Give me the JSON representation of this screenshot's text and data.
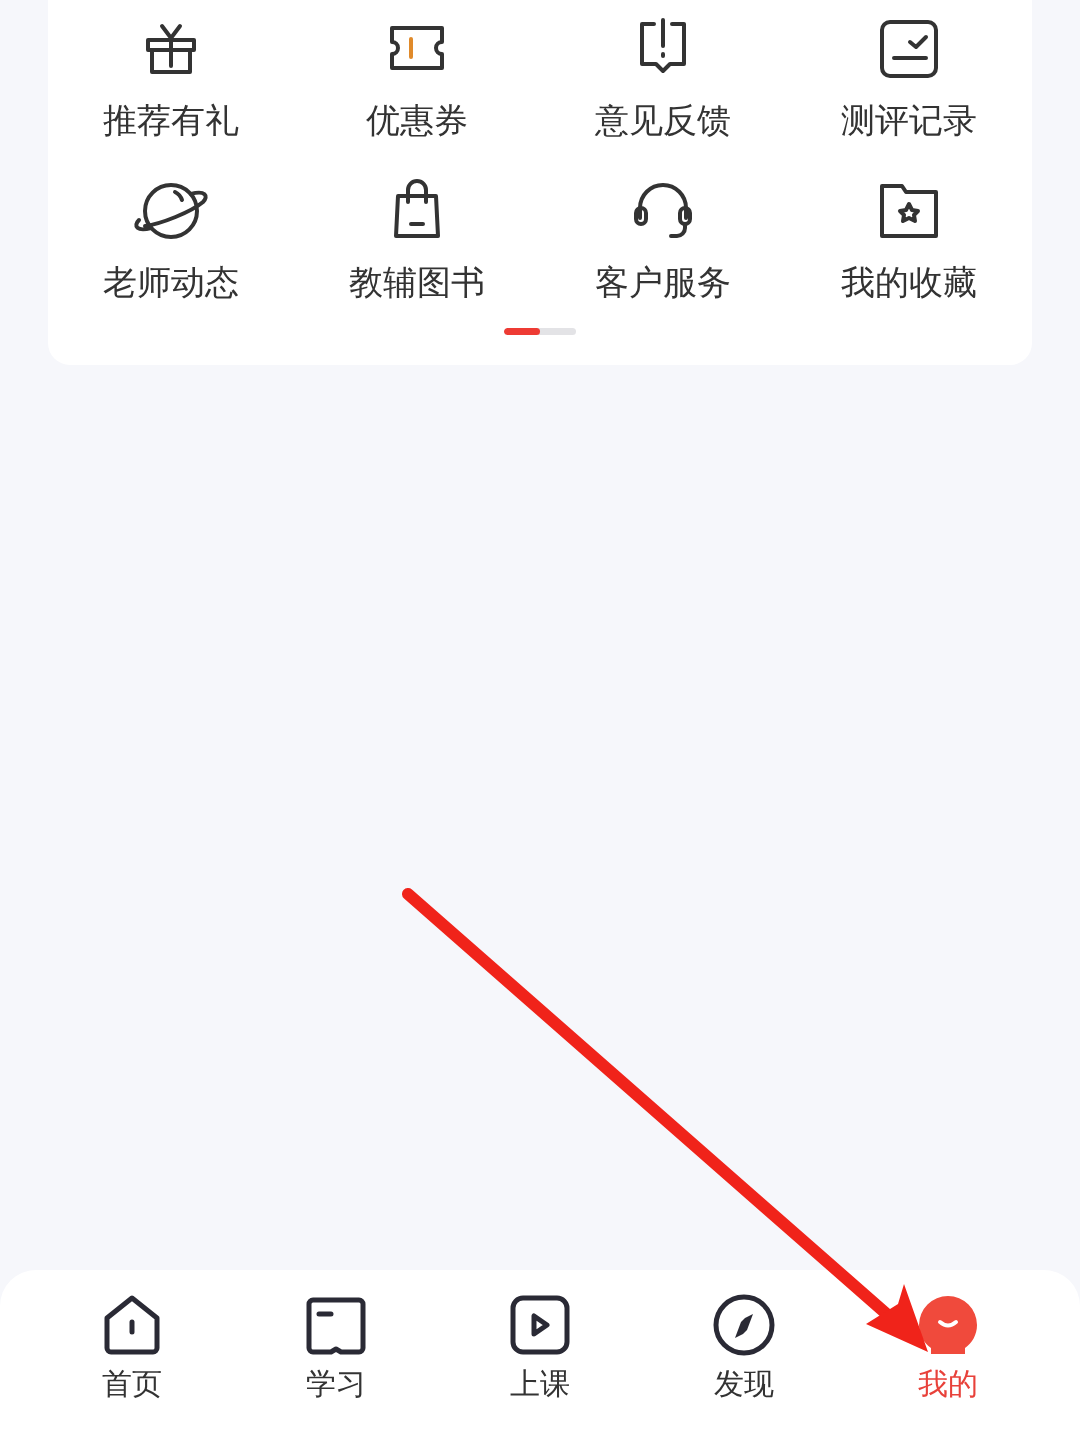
{
  "menu_grid": {
    "items": [
      {
        "label": "推荐有礼"
      },
      {
        "label": "优惠券"
      },
      {
        "label": "意见反馈"
      },
      {
        "label": "测评记录"
      },
      {
        "label": "老师动态"
      },
      {
        "label": "教辅图书"
      },
      {
        "label": "客户服务"
      },
      {
        "label": "我的收藏"
      }
    ],
    "pager": {
      "level": 0.5
    }
  },
  "tab_bar": [
    {
      "label": "首页",
      "selected": false
    },
    {
      "label": "学习",
      "selected": false
    },
    {
      "label": "上课",
      "selected": false
    },
    {
      "label": "发现",
      "selected": false
    },
    {
      "label": "我的",
      "selected": true
    }
  ],
  "annotation": {
    "kind": "arrow"
  }
}
